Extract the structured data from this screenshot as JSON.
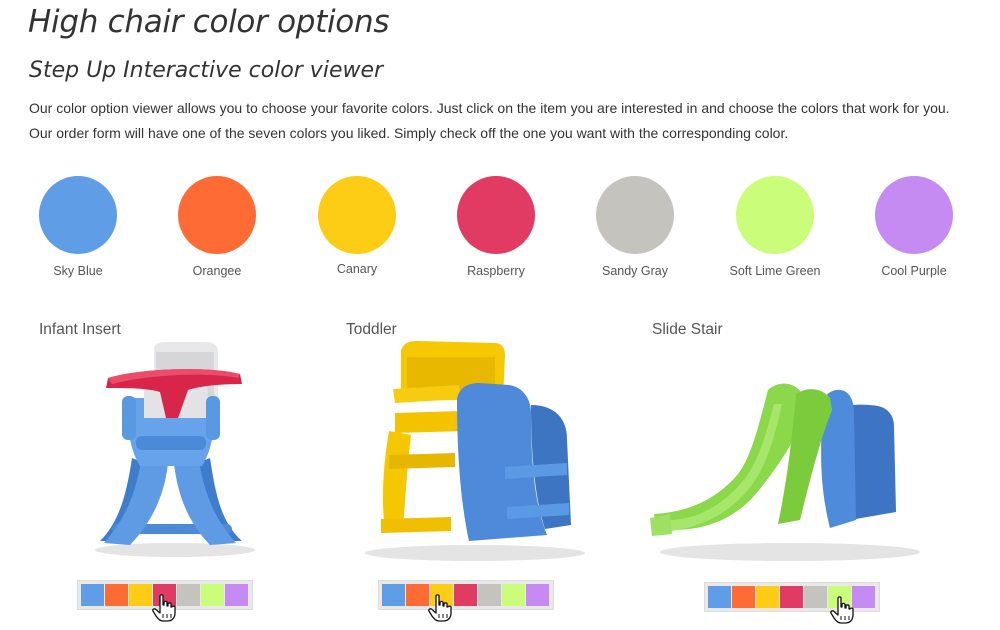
{
  "page": {
    "title": "High chair color options",
    "subtitle": "Step Up Interactive color viewer",
    "intro": "Our color option viewer allows you to choose your favorite colors. Just click on the item you are interested in and choose the colors that work for you. Our order form will have one of the seven colors you liked. Simply check off the one you want with the corresponding color."
  },
  "colors": [
    {
      "name": "Sky Blue",
      "hex": "#5f9ee6"
    },
    {
      "name": "Orangee",
      "hex": "#ff6b35"
    },
    {
      "name": "Canary",
      "hex": "#fdcc14"
    },
    {
      "name": "Raspberry",
      "hex": "#e13a63"
    },
    {
      "name": "Sandy Gray",
      "hex": "#c5c3be"
    },
    {
      "name": "Soft Lime Green",
      "hex": "#cafd7a"
    },
    {
      "name": "Cool Purple",
      "hex": "#c68af3"
    }
  ],
  "products": [
    {
      "title": "Infant Insert",
      "image": "blue high chair with red tray and white infant insert",
      "selected_color": "Raspberry",
      "cursor_icon": "hand-pointer-icon"
    },
    {
      "title": "Toddler",
      "image": "yellow toddler seat with blue step stair",
      "selected_color": "Canary",
      "cursor_icon": "hand-pointer-icon"
    },
    {
      "title": "Slide Stair",
      "image": "lime green slide with blue stair",
      "selected_color": "Soft Lime Green",
      "cursor_icon": "hand-pointer-icon"
    }
  ]
}
